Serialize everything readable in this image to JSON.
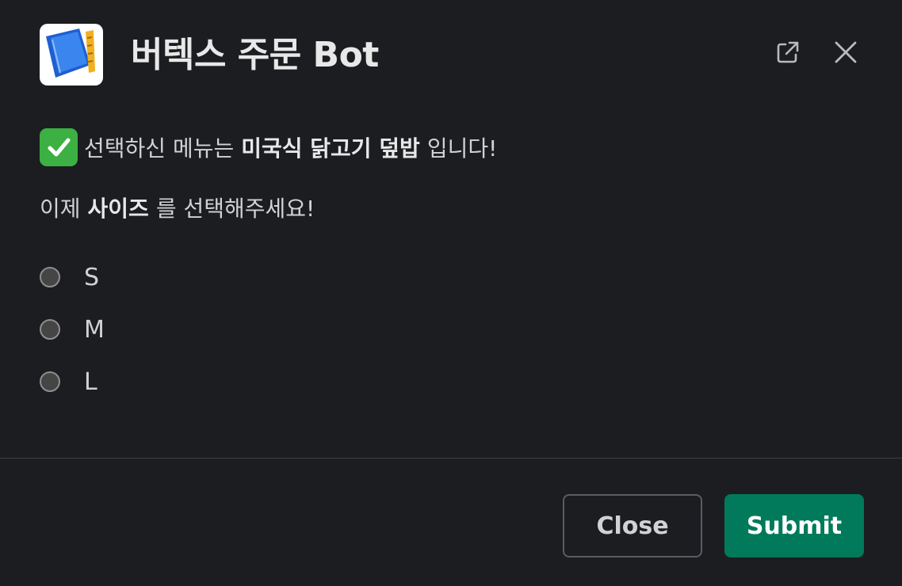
{
  "header": {
    "title": "버텍스 주문 Bot",
    "app_icon": "notebook-with-ruler-icon",
    "open_icon": "external-link-icon",
    "close_icon": "close-icon"
  },
  "message": {
    "emoji": "check-mark-button-icon",
    "prefix": "선택하신 메뉴는",
    "menu": "미국식 닭고기 덮밥",
    "suffix": "입니다!"
  },
  "prompt": {
    "prefix": "이제",
    "field": "사이즈",
    "suffix": "를 선택해주세요!"
  },
  "size_options": [
    {
      "label": "S",
      "selected": false
    },
    {
      "label": "M",
      "selected": false
    },
    {
      "label": "L",
      "selected": false
    }
  ],
  "footer": {
    "close_label": "Close",
    "submit_label": "Submit"
  },
  "colors": {
    "background": "#1b1d21",
    "submit": "#007a5a",
    "check": "#3cb043"
  }
}
